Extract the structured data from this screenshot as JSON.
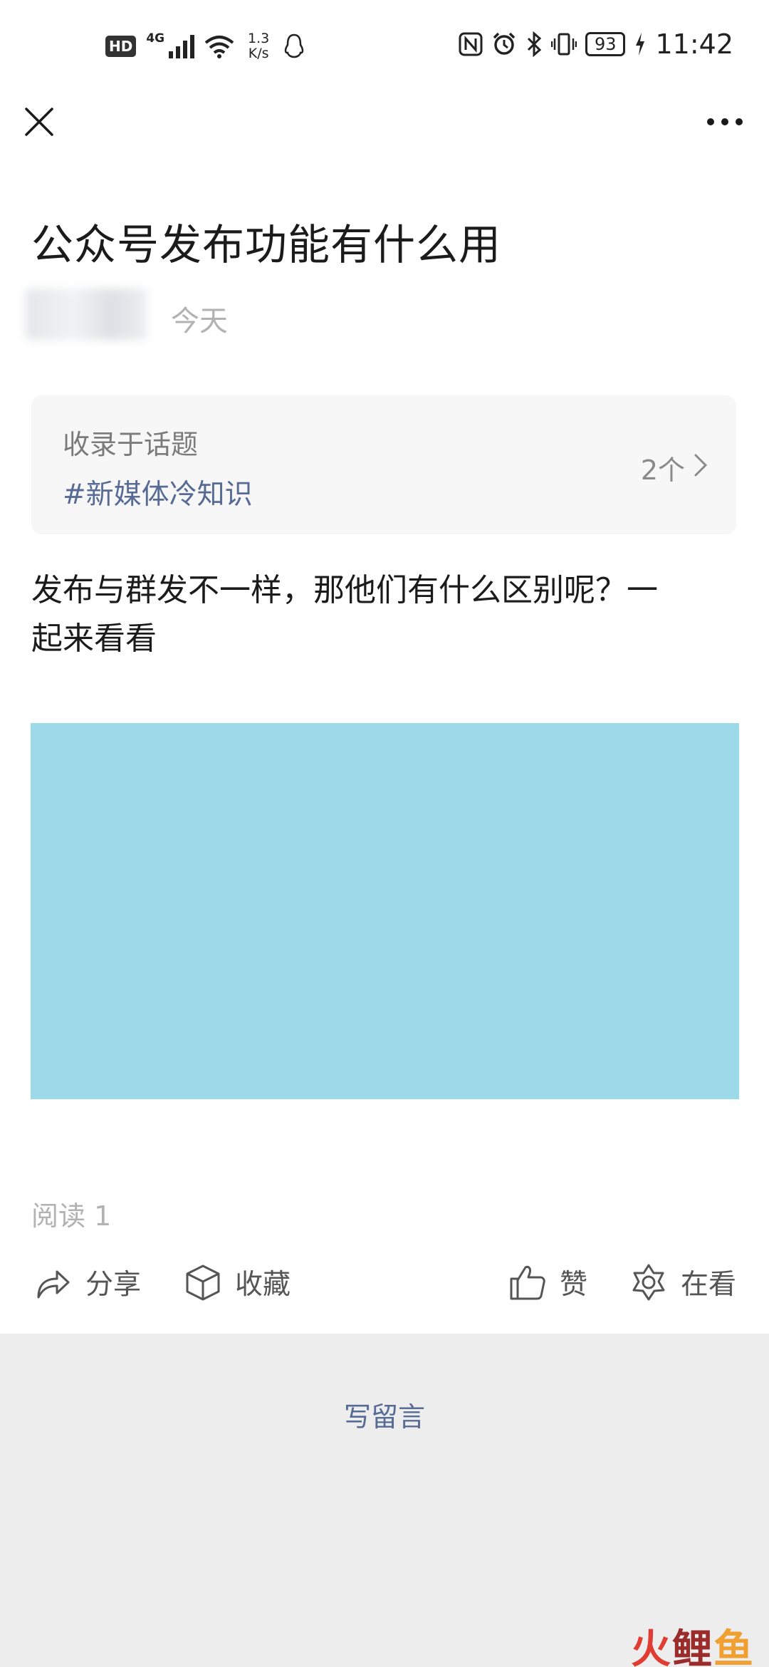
{
  "status_bar": {
    "hd": "HD",
    "network": "4G",
    "speed_value": "1.3",
    "speed_unit": "K/s",
    "battery": "93",
    "time": "11:42"
  },
  "article": {
    "title": "公众号发布功能有什么用",
    "date": "今天",
    "topic": {
      "label": "收录于话题",
      "tag": "#新媒体冷知识",
      "count": "2个"
    },
    "body_line1": "发布与群发不一样，那他们有什么区别呢？一",
    "body_line2": "起来看看",
    "image_color": "#9cdaea",
    "read_count": "阅读 1"
  },
  "actions": {
    "share": "分享",
    "favorite": "收藏",
    "like": "赞",
    "looking": "在看"
  },
  "comment": {
    "label": "写留言"
  },
  "watermark": {
    "char1": "火",
    "char2": "鲤",
    "char3": "鱼"
  },
  "colors": {
    "link": "#576b95",
    "muted": "#b2b2b2",
    "footer_bg": "#ededed"
  }
}
